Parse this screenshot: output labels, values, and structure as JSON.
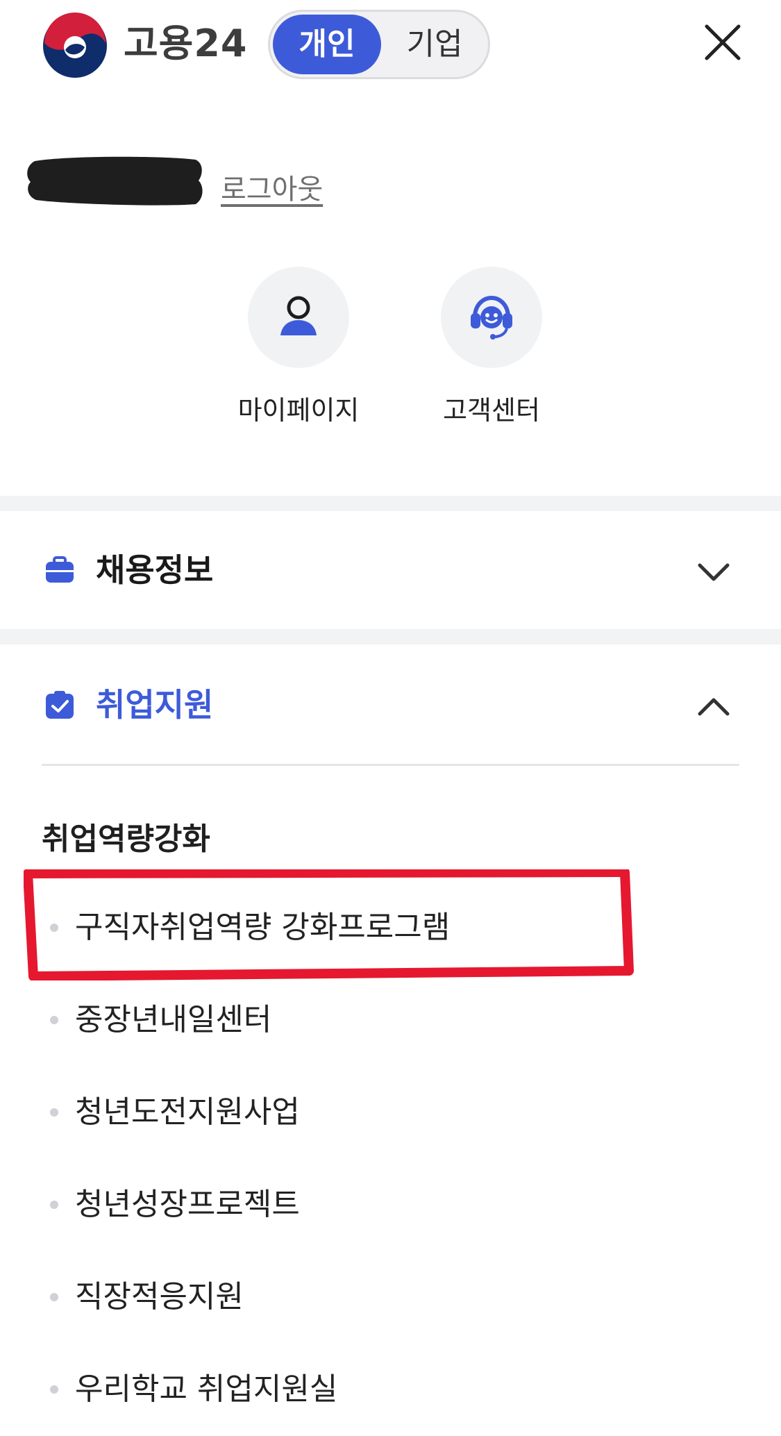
{
  "header": {
    "brand": "고용24",
    "toggle": {
      "active": "개인",
      "inactive": "기업"
    },
    "close_icon": "close-icon"
  },
  "user": {
    "logout_label": "로그아웃"
  },
  "quick_links": [
    {
      "label": "마이페이지",
      "icon": "person-icon"
    },
    {
      "label": "고객센터",
      "icon": "headset-icon"
    }
  ],
  "sections": [
    {
      "title": "채용정보",
      "icon": "briefcase-icon",
      "expanded": false
    },
    {
      "title": "취업지원",
      "icon": "clipboard-check-icon",
      "expanded": true
    }
  ],
  "submenu": {
    "group_title": "취업역량강화",
    "items": [
      "구직자취업역량 강화프로그램",
      "중장년내일센터",
      "청년도전지원사업",
      "청년성장프로젝트",
      "직장적응지원",
      "우리학교 취업지원실"
    ]
  },
  "colors": {
    "accent": "#3d5bd9",
    "highlight_box": "#e5182f",
    "divider": "#f2f3f5"
  }
}
